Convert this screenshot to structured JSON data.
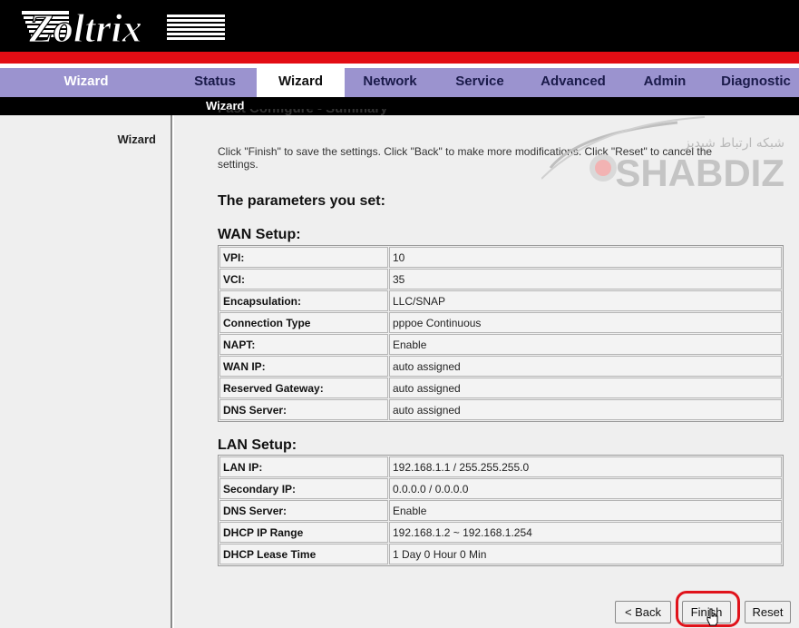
{
  "brand": {
    "logo_text": "Zoltrix"
  },
  "nav": {
    "left_label": "Wizard",
    "tabs": [
      {
        "label": "Status",
        "active": false
      },
      {
        "label": "Wizard",
        "active": true
      },
      {
        "label": "Network",
        "active": false
      },
      {
        "label": "Service",
        "active": false
      },
      {
        "label": "Advanced",
        "active": false
      },
      {
        "label": "Admin",
        "active": false
      },
      {
        "label": "Diagnostic",
        "active": false
      }
    ]
  },
  "subnav": {
    "label": "Wizard"
  },
  "sidebar": {
    "items": [
      "Wizard"
    ]
  },
  "main": {
    "title": "Fast Configure - Summary",
    "intro": "Click \"Finish\" to save the settings. Click \"Back\" to make more modifications. Click \"Reset\" to cancel the settings.",
    "params_heading": "The parameters you set:",
    "wan": {
      "title": "WAN Setup:",
      "rows": [
        {
          "key": "VPI:",
          "value": "10"
        },
        {
          "key": "VCI:",
          "value": "35"
        },
        {
          "key": "Encapsulation:",
          "value": "LLC/SNAP"
        },
        {
          "key": "Connection Type",
          "value": "pppoe Continuous"
        },
        {
          "key": "NAPT:",
          "value": "Enable"
        },
        {
          "key": "WAN IP:",
          "value": "auto assigned"
        },
        {
          "key": "Reserved Gateway:",
          "value": "auto assigned"
        },
        {
          "key": "DNS Server:",
          "value": "auto assigned"
        }
      ]
    },
    "lan": {
      "title": "LAN Setup:",
      "rows": [
        {
          "key": "LAN IP:",
          "value": "192.168.1.1 / 255.255.255.0"
        },
        {
          "key": "Secondary IP:",
          "value": "0.0.0.0 / 0.0.0.0"
        },
        {
          "key": "DNS Server:",
          "value": "Enable"
        },
        {
          "key": "DHCP IP Range",
          "value": "192.168.1.2 ~ 192.168.1.254"
        },
        {
          "key": "DHCP Lease Time",
          "value": "1 Day 0 Hour 0 Min"
        }
      ]
    }
  },
  "buttons": {
    "back": "< Back",
    "finish": "Finish",
    "reset": "Reset"
  },
  "watermark": {
    "line1": "شبکه ارتباط شبدیز",
    "line2": "SHABDIZ"
  },
  "colors": {
    "nav": "#9b93cf",
    "red_bar": "#e30d14",
    "highlight": "#e0131b",
    "background": "#efefef"
  }
}
